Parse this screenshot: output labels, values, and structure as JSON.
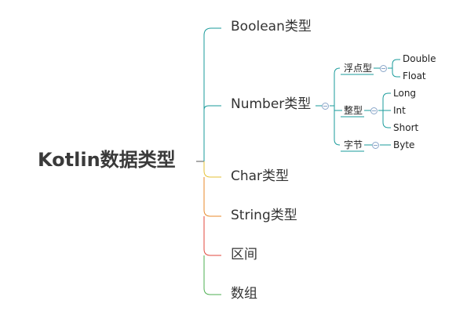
{
  "root": {
    "label": "Kotlin数据类型"
  },
  "branches": [
    {
      "label": "Boolean类型",
      "color": "#1a9b9b"
    },
    {
      "label": "Number类型",
      "color": "#1a9b9b",
      "children": [
        {
          "label": "浮点型",
          "children": [
            "Double",
            "Float"
          ]
        },
        {
          "label": "整型",
          "children": [
            "Long",
            "Int",
            "Short"
          ]
        },
        {
          "label": "字节",
          "children": [
            "Byte"
          ]
        }
      ]
    },
    {
      "label": "Char类型",
      "color": "#e6c235"
    },
    {
      "label": "String类型",
      "color": "#e88a2a"
    },
    {
      "label": "区间",
      "color": "#e0473d"
    },
    {
      "label": "数组",
      "color": "#4caf50"
    }
  ]
}
